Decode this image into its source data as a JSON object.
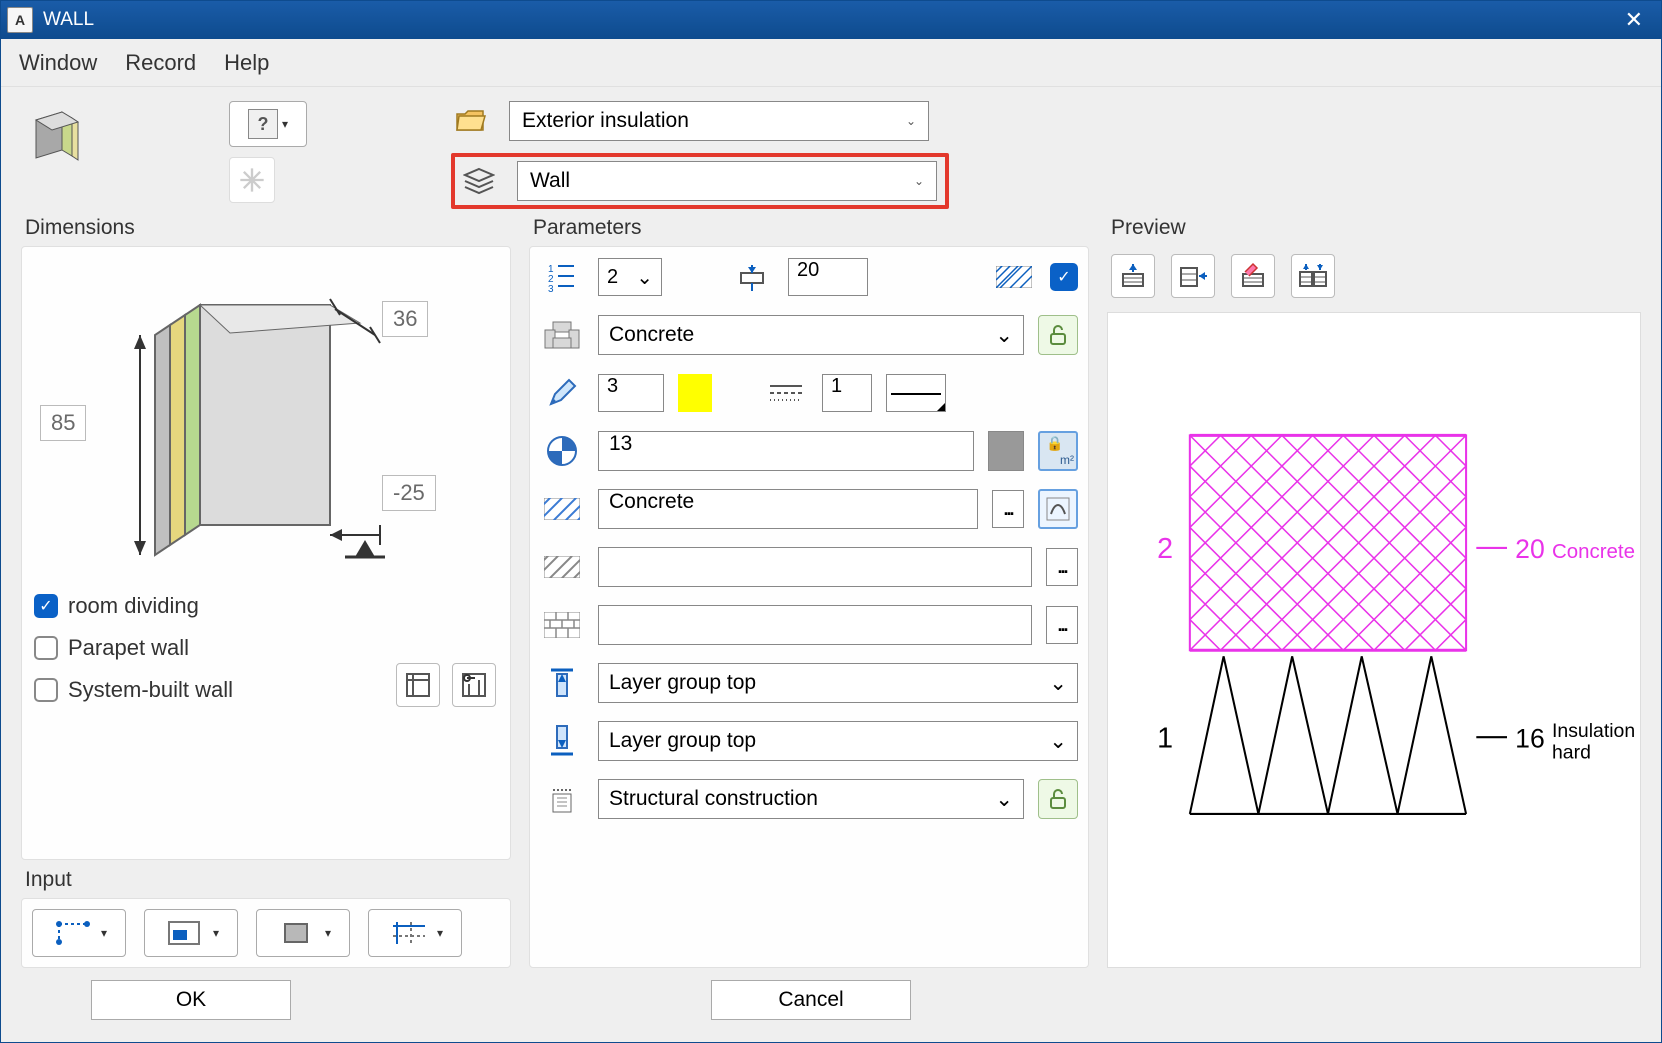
{
  "window": {
    "title": "WALL"
  },
  "menu": {
    "window": "Window",
    "record": "Record",
    "help": "Help"
  },
  "toolbar": {
    "folder_selection": "Exterior insulation",
    "layer_selection": "Wall"
  },
  "dimensions": {
    "title": "Dimensions",
    "height_label": "85",
    "width_label": "36",
    "offset_label": "-25",
    "checks": {
      "room_dividing": "room dividing",
      "parapet_wall": "Parapet wall",
      "system_built_wall": "System-built wall"
    }
  },
  "input": {
    "title": "Input"
  },
  "parameters": {
    "title": "Parameters",
    "layer_number": "2",
    "thickness": "20",
    "material": "Concrete",
    "pen": "3",
    "linetype": "1",
    "surface_elem": "13",
    "hatching": "Concrete",
    "pattern": "",
    "fill": "",
    "top_group": "Layer group top",
    "bottom_group": "Layer group top",
    "trade": "Structural construction"
  },
  "preview": {
    "title": "Preview",
    "layers": [
      {
        "num": "2",
        "thickness": "20",
        "name": "Concrete"
      },
      {
        "num": "1",
        "thickness": "16",
        "name_line1": "Insulation",
        "name_line2": "hard"
      }
    ]
  },
  "buttons": {
    "ok": "OK",
    "cancel": "Cancel"
  }
}
